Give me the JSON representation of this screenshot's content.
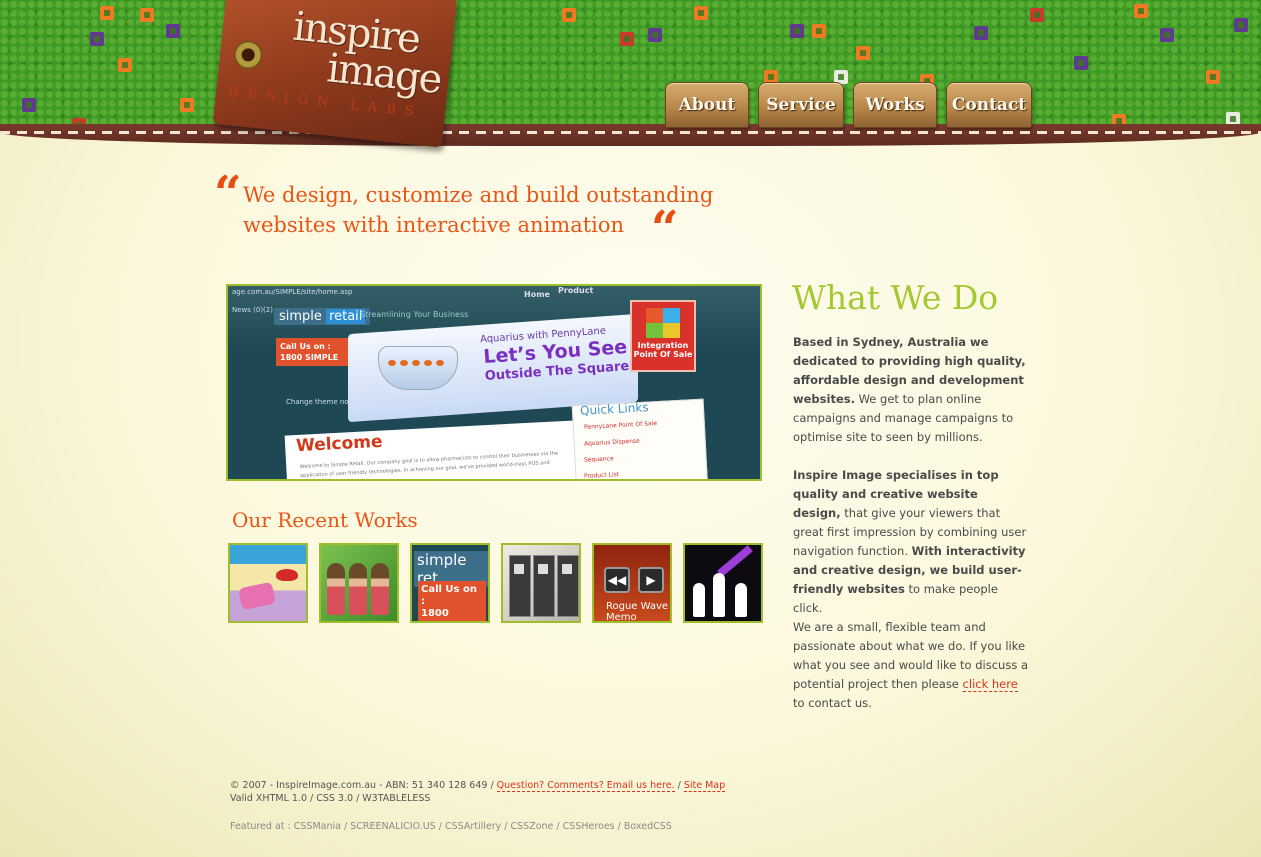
{
  "header": {
    "logo": {
      "line1": "inspire",
      "line2": "image",
      "line3": "DESIGN LABS"
    },
    "nav": [
      "About",
      "Service",
      "Works",
      "Contact"
    ]
  },
  "tagline": {
    "line1": "We design, customize and build outstanding",
    "line2": "websites with interactive animation",
    "open_quote": "“",
    "close_quote": "“"
  },
  "feature": {
    "url": "age.com.au/SIMPLE/site/home.asp",
    "news": "News (0)(2) ▸",
    "brand_a": "simple",
    "brand_b": "retail",
    "stream": "Streamlining Your Business",
    "nav_home": "Home",
    "nav_product": "Product",
    "call_line1": "Call Us on :",
    "call_line2": "1800 SIMPLE",
    "aq": "Aquarius with PennyLane",
    "lys1": "Let’s You See",
    "lys2": "Outside The Square",
    "integ1": "Integration",
    "integ2": "Point Of Sale",
    "welcome": "Welcome",
    "body": "Welcome to Simple Retail. Our company goal is to allow pharmacists to control their businesses via the application of user friendly technologies. In achieving our goal, we've provided world-class POS and integration solutions.",
    "change_theme": "Change theme now",
    "quick_links": "Quick Links",
    "ql_items": [
      "PennyLane Point Of Sale",
      "Aquarius Dispense",
      "Sequence",
      "Product List"
    ]
  },
  "recent": {
    "title": "Our Recent Works",
    "t3_a": "simple ret",
    "t3_b1": "Call Us on :",
    "t3_b2": "1800 SIMPLE",
    "t5_label": "Rogue Wave Memo"
  },
  "what_we_do": {
    "title": "What We Do",
    "p1_bold": "Based in Sydney, Australia we dedicated to providing high quality, affordable design and development websites.",
    "p1_rest": " We get to plan online campaigns and manage campaigns to optimise site to seen by millions.",
    "p2_bold1": "Inspire Image specialises in top quality and creative website design,",
    "p2_rest1": " that give your viewers that great first impression by combining user navigation function. ",
    "p2_bold2": "With interactivity and creative design, we build user-friendly websites",
    "p2_rest2": " to make people click.",
    "p3_pre": "We are a small, flexible team and passionate about what we do. If you like what you see and would like to discuss a potential project then please ",
    "p3_link": "click here",
    "p3_post": " to contact us."
  },
  "footer": {
    "line1_text": "© 2007 - InspireImage.com.au - ABN: 51 340 128 649 / ",
    "line1_link1": "Question? Comments? Email us here.",
    "sep": " / ",
    "line1_link2": "Site Map",
    "line2": "Valid XHTML 1.0 / CSS 3.0 / W3TABLELESS",
    "featured_label": "Featured at : ",
    "featured_sites": [
      "CSSMania",
      "SCREENALICIO.US",
      "CSSArtillery",
      "CSSZone",
      "CSSHeroes",
      "BoxedCSS"
    ]
  },
  "colors": {
    "accent_orange": "#e85516",
    "accent_green": "#a3c832",
    "link_red": "#d9331a"
  }
}
